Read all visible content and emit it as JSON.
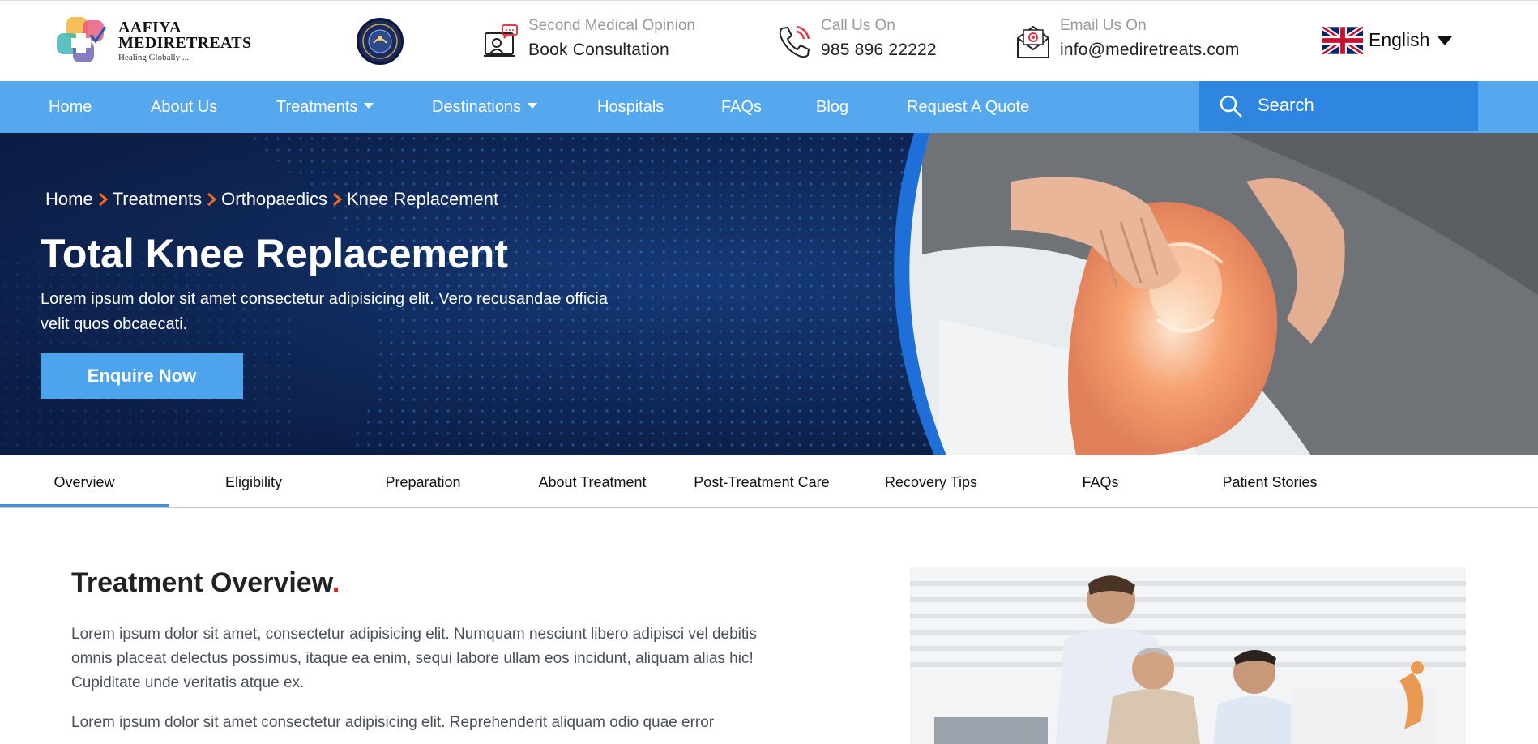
{
  "logo": {
    "name_line1": "AAFIYA",
    "name_line2": "MEDIRETREATS",
    "tagline": "Healing Globally ...."
  },
  "contacts": [
    {
      "icon": "consultation-icon",
      "label": "Second Medical Opinion",
      "value": "Book Consultation"
    },
    {
      "icon": "phone-icon",
      "label": "Call Us On",
      "value": "985 896 22222"
    },
    {
      "icon": "email-icon",
      "label": "Email Us On",
      "value": "info@mediretreats.com"
    }
  ],
  "language": {
    "label": "English",
    "icon": "uk-flag-icon"
  },
  "nav": {
    "items": [
      {
        "label": "Home"
      },
      {
        "label": "About Us"
      },
      {
        "label": "Treatments",
        "dropdown": true
      },
      {
        "label": "Destinations",
        "dropdown": true
      },
      {
        "label": "Hospitals"
      },
      {
        "label": "FAQs"
      },
      {
        "label": "Blog"
      },
      {
        "label": "Request A Quote"
      }
    ],
    "search": {
      "placeholder": "Search",
      "icon": "search-icon"
    }
  },
  "hero": {
    "breadcrumb": [
      "Home",
      "Treatments",
      "Orthopaedics",
      "Knee Replacement"
    ],
    "title": "Total Knee Replacement",
    "description": "Lorem ipsum dolor sit amet consectetur adipisicing elit. Vero recusandae officia velit quos obcaecati.",
    "cta": "Enquire Now"
  },
  "tabs": {
    "items": [
      "Overview",
      "Eligibility",
      "Preparation",
      "About Treatment",
      "Post-Treatment Care",
      "Recovery Tips",
      "FAQs",
      "Patient Stories"
    ],
    "active": "Overview"
  },
  "overview": {
    "title": "Treatment Overview",
    "title_dot": ".",
    "paragraph1": "Lorem ipsum dolor sit amet, consectetur adipisicing elit. Numquam nesciunt libero adipisci vel debitis omnis placeat delectus possimus, itaque ea enim, sequi labore ullam eos incidunt, aliquam alias hic! Cupiditate unde veritatis atque ex.",
    "paragraph2": "Lorem ipsum dolor sit amet consectetur adipisicing elit. Reprehenderit aliquam odio quae error"
  },
  "colors": {
    "nav_bg": "#55a8ee",
    "search_bg": "#2e86e0",
    "hero_bg": "#0d2350",
    "accent_orange": "#f26a21",
    "title_dot": "#e02020",
    "tab_underline": "#4a90d9"
  }
}
